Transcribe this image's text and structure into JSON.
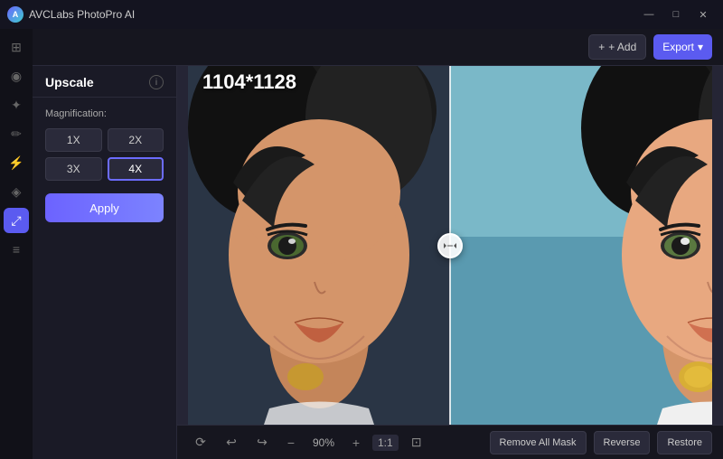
{
  "titlebar": {
    "app_name": "AVCLabs PhotoPro AI",
    "minimize_label": "—",
    "maximize_label": "□",
    "close_label": "✕"
  },
  "header": {
    "add_label": "+ Add",
    "export_label": "Export",
    "export_chevron": "▾"
  },
  "panel": {
    "title": "Upscale",
    "info_label": "i",
    "magnification_label": "Magnification:",
    "mag_options": [
      {
        "label": "1X",
        "value": "1x",
        "active": false
      },
      {
        "label": "2X",
        "value": "2x",
        "active": false
      },
      {
        "label": "3X",
        "value": "3x",
        "active": false
      },
      {
        "label": "4X",
        "value": "4x",
        "active": true
      }
    ],
    "apply_label": "Apply"
  },
  "canvas": {
    "resolution": "1104*1128"
  },
  "toolbar": {
    "zoom_value": "90%",
    "zoom_ratio": "1:1",
    "remove_all_mask_label": "Remove All Mask",
    "reverse_label": "Reverse",
    "restore_label": "Restore"
  },
  "icons": {
    "sidebar": [
      {
        "name": "home-icon",
        "glyph": "⊞"
      },
      {
        "name": "face-icon",
        "glyph": "◉"
      },
      {
        "name": "star-icon",
        "glyph": "✦"
      },
      {
        "name": "brush-icon",
        "glyph": "✏"
      },
      {
        "name": "magic-icon",
        "glyph": "⚡"
      },
      {
        "name": "paint-icon",
        "glyph": "◈"
      },
      {
        "name": "upscale-icon",
        "glyph": "⤢"
      },
      {
        "name": "sliders-icon",
        "glyph": "≡"
      }
    ]
  }
}
